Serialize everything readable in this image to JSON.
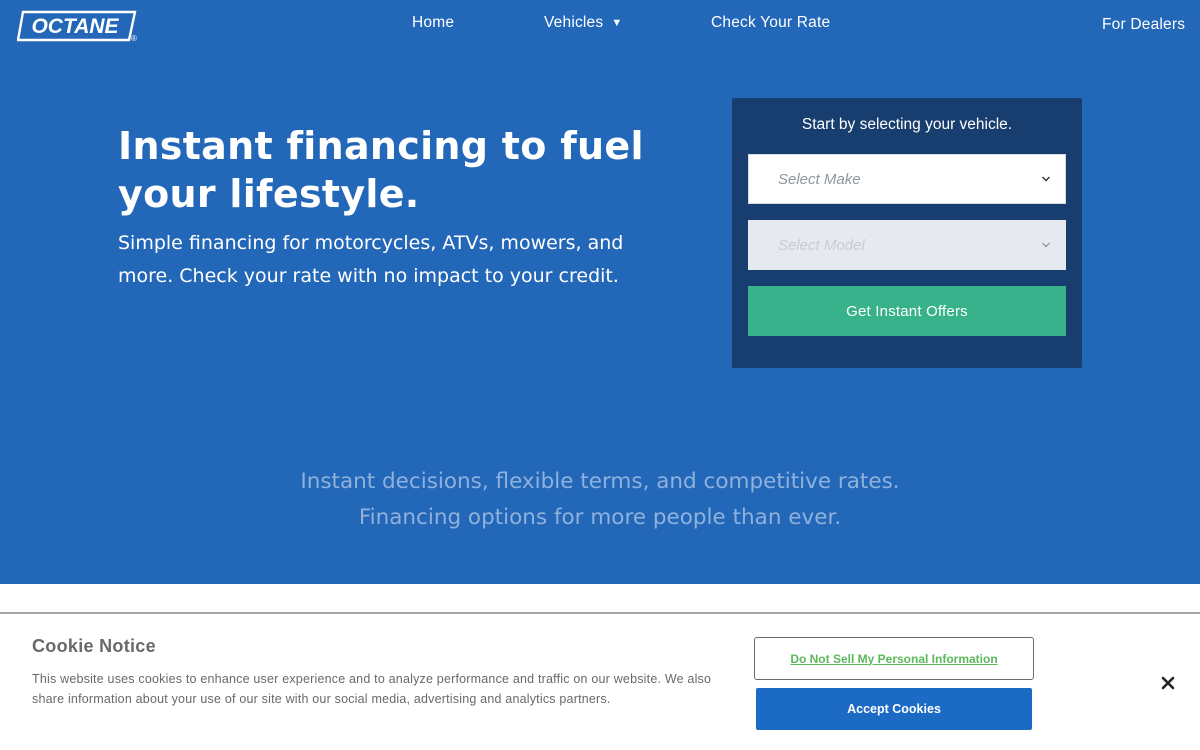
{
  "header": {
    "logo_text": "OCTANE",
    "nav": {
      "home": "Home",
      "vehicles": "Vehicles",
      "vehicles_caret": "▼",
      "check_rate": "Check Your Rate",
      "dealers": "For Dealers"
    }
  },
  "hero": {
    "title": "Instant financing to fuel your lifestyle.",
    "subtitle": "Simple financing for motorcycles, ATVs, mowers, and more. Check your rate with no impact to your credit."
  },
  "form": {
    "prompt": "Start by selecting your vehicle.",
    "make_placeholder": "Select Make",
    "model_placeholder": "Select Model",
    "submit_label": "Get Instant Offers"
  },
  "tagline": {
    "line1": "Instant decisions, flexible terms, and competitive rates.",
    "line2": "Financing options for more people than ever."
  },
  "cookie": {
    "title": "Cookie Notice",
    "text": "This website uses cookies to enhance user experience and to analyze performance and traffic on our website. We also share information about your use of our site with our social media, advertising and analytics partners.",
    "do_not_sell_label": "Do Not Sell My Personal Information",
    "accept_label": "Accept Cookies"
  },
  "colors": {
    "hero_bg": "#2367b8",
    "card_bg": "#173e6e",
    "cta_green": "#38b28a",
    "accept_blue": "#1b6ac4",
    "link_green": "#5cb85c"
  },
  "icons": {
    "vehicles_dropdown": "caret-down-icon",
    "select_chevron": "chevron-down-icon",
    "close": "close-icon"
  }
}
